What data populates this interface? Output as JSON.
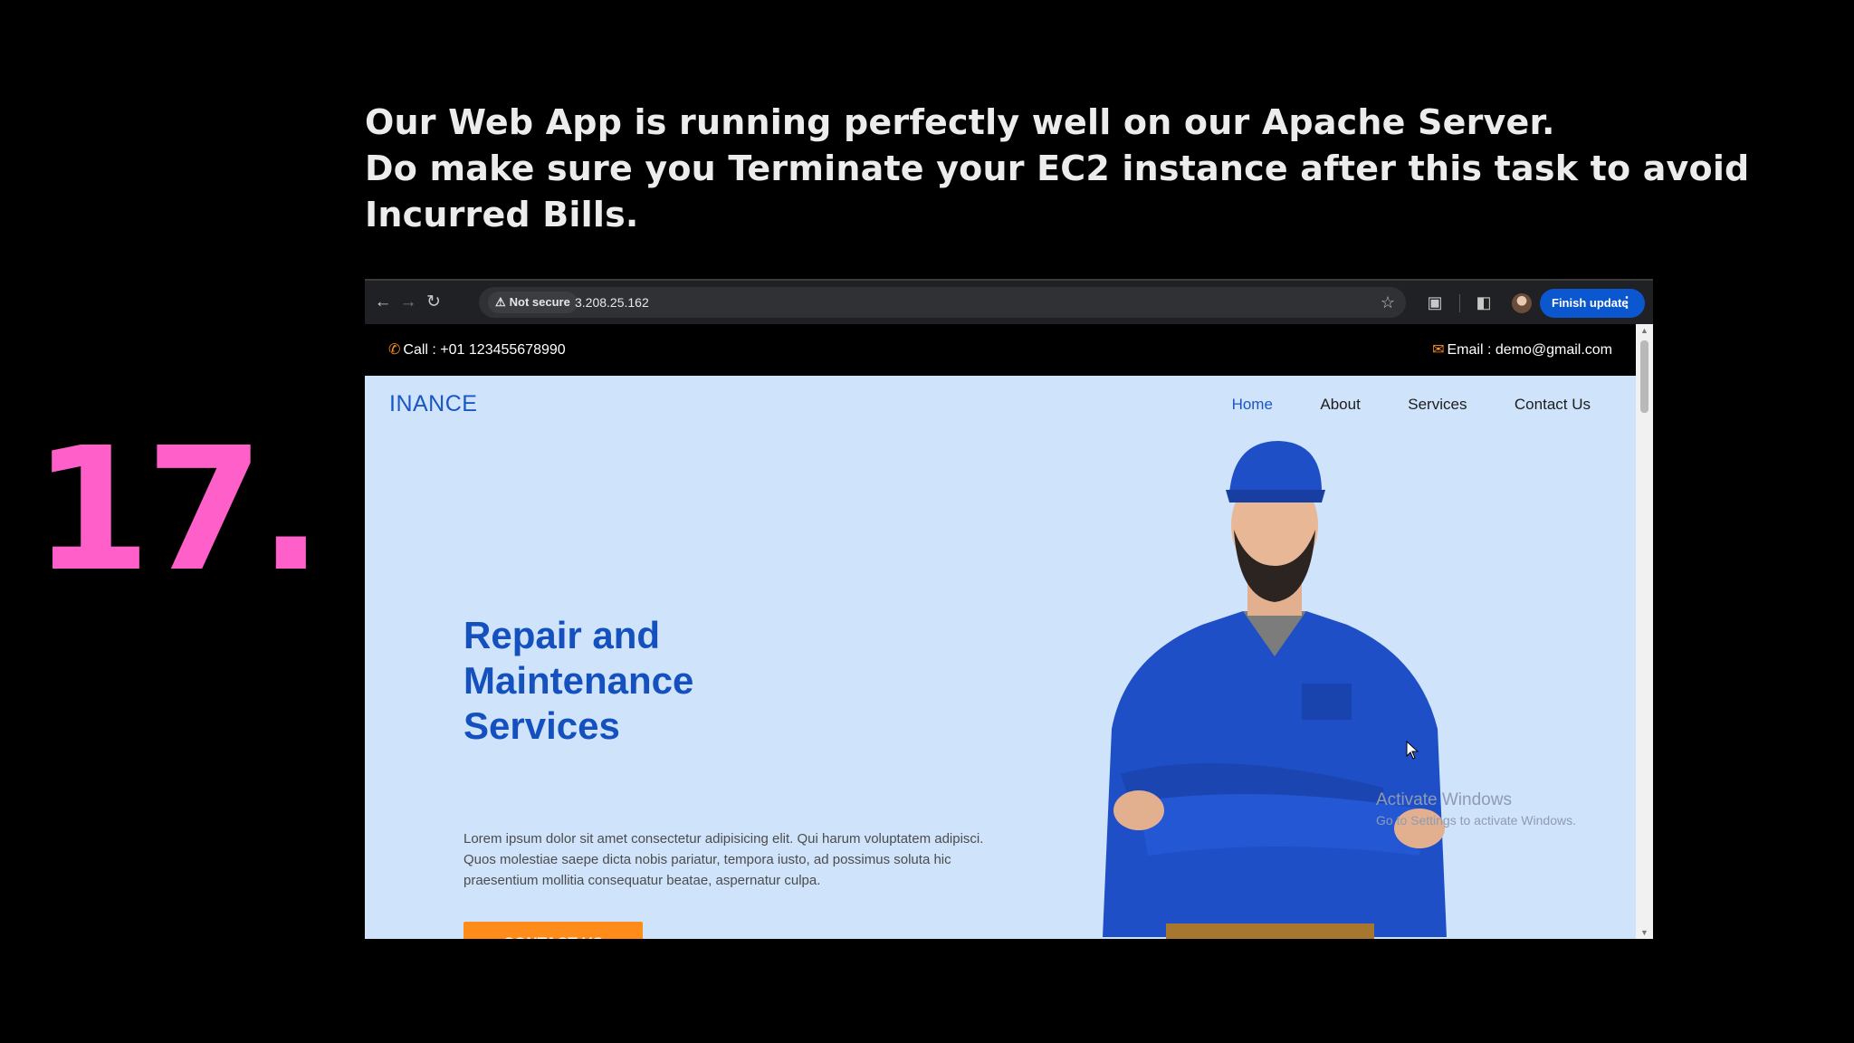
{
  "slide": {
    "heading_lines": [
      "Our Web App is running perfectly well on our Apache Server.",
      "Do make sure you Terminate your EC2 instance after this task to avoid",
      "Incurred Bills."
    ],
    "step_number": "17.",
    "step_number_color": "#ff5fc8"
  },
  "browser": {
    "security_label": "Not secure",
    "url": "3.208.25.162",
    "update_button": "Finish update",
    "icons": [
      "back-arrow-icon",
      "forward-arrow-icon",
      "reload-icon",
      "warning-icon",
      "bookmark-star-icon",
      "extensions-icon",
      "side-panel-icon",
      "profile-avatar",
      "kebab-menu-icon"
    ]
  },
  "site": {
    "call": "Call : +01 123455678990",
    "email": "Email : demo@gmail.com",
    "brand": "INANCE",
    "nav": [
      "Home",
      "About",
      "Services",
      "Contact Us"
    ],
    "active_nav": "Home",
    "hero_title": [
      "Repair and",
      "Maintenance",
      "Services"
    ],
    "hero_text": "Lorem ipsum dolor sit amet consectetur adipisicing elit. Qui harum voluptatem adipisci. Quos molestiae saepe dicta nobis pariatur, tempora iusto, ad possimus soluta hic praesentium mollitia consequatur beatae, aspernatur culpa.",
    "cta": "CONTACT US",
    "colors": {
      "brand_blue": "#1a57c6",
      "hero_bg": "#cfe3fb",
      "cta_orange": "#ff8c1a",
      "topbar_bg": "#000000"
    }
  },
  "watermark": {
    "title": "Activate Windows",
    "subtitle": "Go to Settings to activate Windows."
  }
}
